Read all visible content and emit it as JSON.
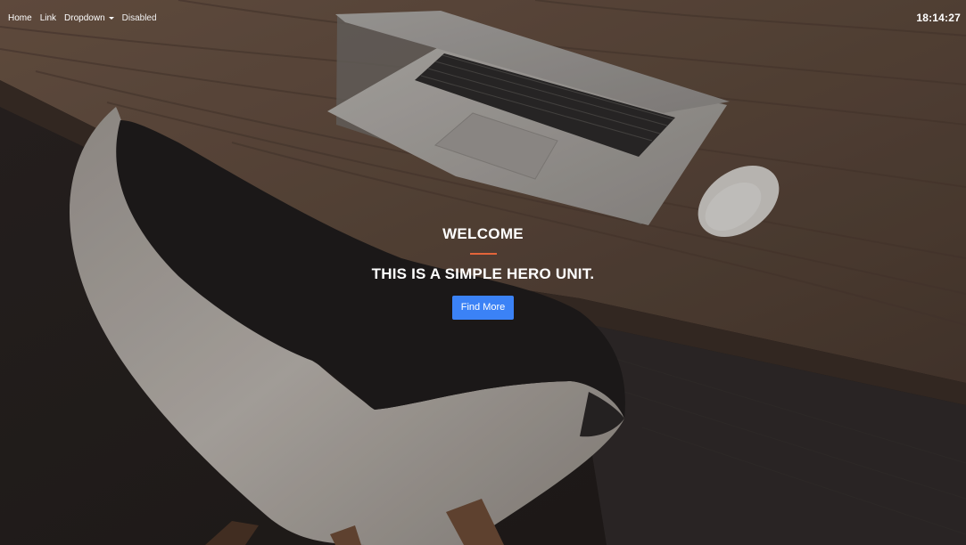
{
  "navbar": {
    "links": [
      {
        "label": "Home"
      },
      {
        "label": "Link"
      },
      {
        "label": "Dropdown"
      },
      {
        "label": "Disabled"
      }
    ],
    "clock": "18:14:27"
  },
  "hero": {
    "kicker": "WELCOME",
    "title": "THIS IS A SIMPLE HERO UNIT.",
    "button_label": "Find More"
  },
  "colors": {
    "accent_divider": "#e3653a",
    "button": "#3b82f6",
    "text": "#ffffff"
  },
  "icons": {
    "dropdown": "caret-down-icon"
  }
}
